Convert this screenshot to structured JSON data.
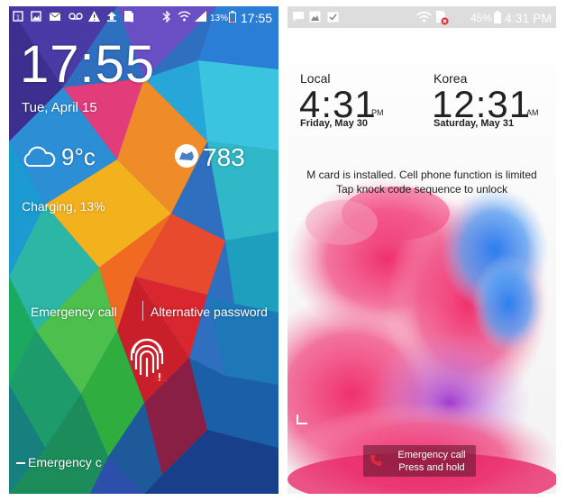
{
  "left_screen": {
    "status": {
      "battery": "13%",
      "time": "17:55",
      "icons": [
        "calendar-icon",
        "gallery-icon",
        "email-icon",
        "voicemail-icon",
        "warning-icon",
        "upload-icon",
        "sim-error-icon",
        "bluetooth-icon",
        "wifi-icon",
        "signal-icon",
        "battery-icon"
      ]
    },
    "clock": "17:55",
    "date": "Tue, April 15",
    "weather": {
      "icon": "cloud-icon",
      "temperature": "9°c"
    },
    "steps": {
      "icon": "shoe-icon",
      "count": "783"
    },
    "charging": "Charging, 13%",
    "emergency_call": "Emergency call",
    "alternative_password": "Alternative password",
    "fingerprint_icon": "fingerprint-icon",
    "bottom_emergency": "Emergency c"
  },
  "right_screen": {
    "status": {
      "battery": "45%",
      "time": "4:31 PM",
      "icons": [
        "chat-icon",
        "gallery-icon",
        "task-icon",
        "wifi-icon",
        "sim-error-icon",
        "signal-icon",
        "battery-icon"
      ]
    },
    "local": {
      "label": "Local",
      "time": "4:31",
      "ampm": "PM",
      "date": "Friday, May 30"
    },
    "korea": {
      "label": "Korea",
      "time": "12:31",
      "ampm": "AM",
      "date": "Saturday, May 31"
    },
    "sim_message": "M card is installed. Cell phone function is limited",
    "knock_message": "Tap knock code sequence to unlock",
    "emergency": {
      "icon": "phone-icon",
      "line1": "Emergency call",
      "line2": "Press and hold"
    }
  }
}
